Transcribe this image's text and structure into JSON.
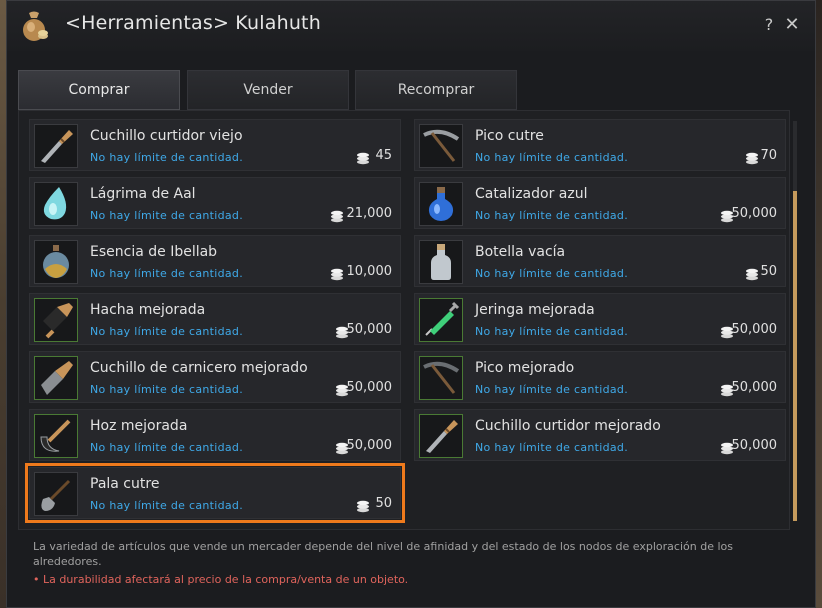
{
  "window": {
    "title": "<Herramientas> Kulahuth",
    "help_label": "?",
    "close_label": "✕"
  },
  "tabs": [
    {
      "label": "Comprar",
      "active": true
    },
    {
      "label": "Vender",
      "active": false
    },
    {
      "label": "Recomprar",
      "active": false
    }
  ],
  "items": [
    {
      "name": "Cuchillo curtidor viejo",
      "limit": "No hay límite de cantidad.",
      "price": "45",
      "icon": "tanning-knife-icon"
    },
    {
      "name": "Pico cutre",
      "limit": "No hay límite de cantidad.",
      "price": "70",
      "icon": "pickaxe-icon"
    },
    {
      "name": "Lágrima de Aal",
      "limit": "No hay límite de cantidad.",
      "price": "21,000",
      "icon": "water-drop-icon"
    },
    {
      "name": "Catalizador azul",
      "limit": "No hay límite de cantidad.",
      "price": "50,000",
      "icon": "blue-flask-icon"
    },
    {
      "name": "Esencia de Ibellab",
      "limit": "No hay límite de cantidad.",
      "price": "10,000",
      "icon": "essence-bottle-icon"
    },
    {
      "name": "Botella vacía",
      "limit": "No hay límite de cantidad.",
      "price": "50",
      "icon": "empty-bottle-icon"
    },
    {
      "name": "Hacha mejorada",
      "limit": "No hay límite de cantidad.",
      "price": "50,000",
      "icon": "axe-icon"
    },
    {
      "name": "Jeringa mejorada",
      "limit": "No hay límite de cantidad.",
      "price": "50,000",
      "icon": "syringe-icon"
    },
    {
      "name": "Cuchillo de carnicero mejorado",
      "limit": "No hay límite de cantidad.",
      "price": "50,000",
      "icon": "butcher-knife-icon"
    },
    {
      "name": "Pico mejorado",
      "limit": "No hay límite de cantidad.",
      "price": "50,000",
      "icon": "pickaxe-icon"
    },
    {
      "name": "Hoz mejorada",
      "limit": "No hay límite de cantidad.",
      "price": "50,000",
      "icon": "sickle-icon"
    },
    {
      "name": "Cuchillo curtidor mejorado",
      "limit": "No hay límite de cantidad.",
      "price": "50,000",
      "icon": "tanning-knife-icon"
    },
    {
      "name": "Pala cutre",
      "limit": "No hay límite de cantidad.",
      "price": "50",
      "icon": "shovel-icon"
    }
  ],
  "footer": {
    "note": "La variedad de artículos que vende un mercader depende del nivel de afinidad y del estado de los nodos de exploración de los alrededores.",
    "warning": "• La durabilidad afectará al precio de la compra/venta de un objeto."
  },
  "colors": {
    "accent_highlight": "#ef7a1c",
    "limit_text": "#3fa9e8",
    "warning_text": "#e0645c",
    "scroll_thumb": "#c59a5c"
  }
}
